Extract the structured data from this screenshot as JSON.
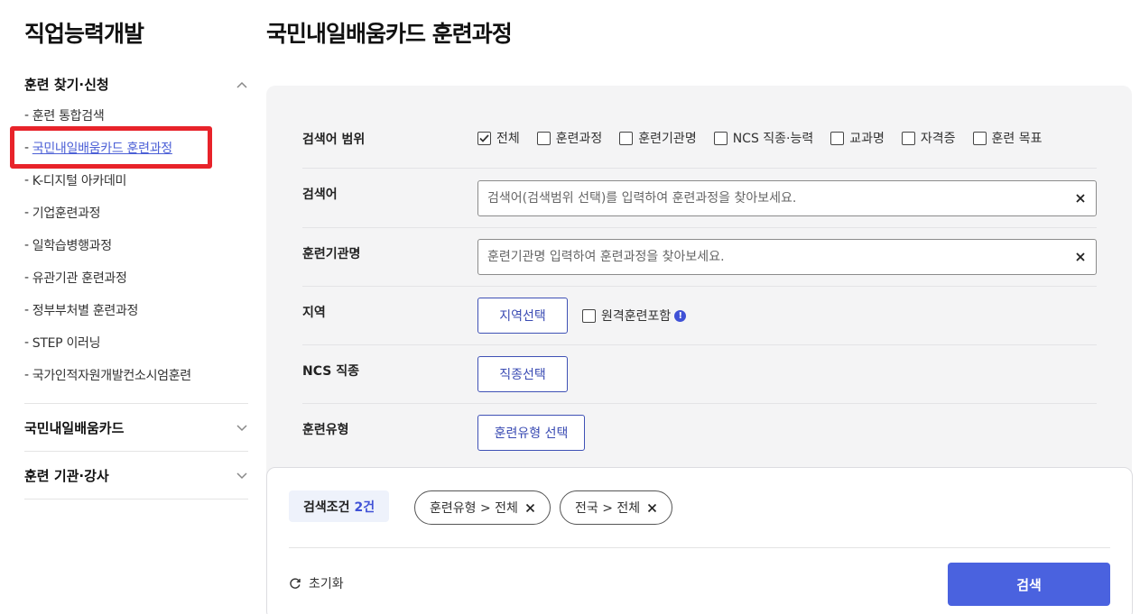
{
  "sidebar": {
    "title": "직업능력개발",
    "groups": [
      {
        "label": "훈련 찾기·신청",
        "expanded": true
      },
      {
        "label": "국민내일배움카드",
        "expanded": false
      },
      {
        "label": "훈련 기관·강사",
        "expanded": false
      }
    ],
    "items": [
      {
        "label": "훈련 통합검색"
      },
      {
        "label": "국민내일배움카드 훈련과정",
        "active": true
      },
      {
        "label": "K-디지털 아카데미"
      },
      {
        "label": "기업훈련과정"
      },
      {
        "label": "일학습병행과정"
      },
      {
        "label": "유관기관 훈련과정"
      },
      {
        "label": "정부부처별 훈련과정"
      },
      {
        "label": "STEP 이러닝"
      },
      {
        "label": "국가인적자원개발컨소시엄훈련"
      }
    ],
    "dash": "-"
  },
  "main": {
    "title": "국민내일배움카드 훈련과정",
    "scope": {
      "label": "검색어 범위",
      "options": [
        {
          "label": "전체",
          "checked": true
        },
        {
          "label": "훈련과정",
          "checked": false
        },
        {
          "label": "훈련기관명",
          "checked": false
        },
        {
          "label": "NCS 직종·능력",
          "checked": false
        },
        {
          "label": "교과명",
          "checked": false
        },
        {
          "label": "자격증",
          "checked": false
        },
        {
          "label": "훈련 목표",
          "checked": false
        }
      ]
    },
    "keyword": {
      "label": "검색어",
      "placeholder": "검색어(검색범위 선택)를 입력하여 훈련과정을 찾아보세요.",
      "value": ""
    },
    "institution": {
      "label": "훈련기관명",
      "placeholder": "훈련기관명 입력하여 훈련과정을 찾아보세요.",
      "value": ""
    },
    "region": {
      "label": "지역",
      "button": "지역선택",
      "remote_label": "원격훈련포함",
      "remote_checked": false,
      "info_glyph": "!"
    },
    "ncs": {
      "label": "NCS 직종",
      "button": "직종선택"
    },
    "type": {
      "label": "훈련유형",
      "button": "훈련유형 선택"
    }
  },
  "conditions": {
    "label": "검색조건",
    "count": "2건",
    "chips": [
      "훈련유형 > 전체",
      "전국 > 전체"
    ],
    "reset_label": "초기화",
    "search_label": "검색"
  },
  "colors": {
    "accent": "#4a62df",
    "highlight": "#e8232a",
    "panel_bg": "#f4f4f5"
  }
}
